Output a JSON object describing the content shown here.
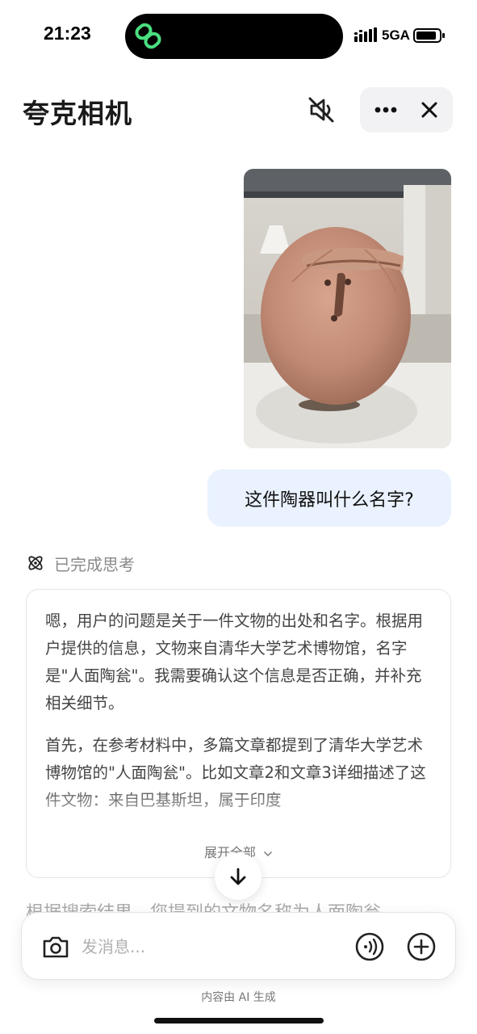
{
  "status_bar": {
    "time": "21:23",
    "network": "5GA",
    "island_icon": "link-rings-icon"
  },
  "header": {
    "title": "夸克相机",
    "icons": [
      "speaker-muted-icon",
      "more-icon",
      "close-icon"
    ]
  },
  "conversation": {
    "user_image": {
      "icon": "pottery-photo",
      "description_hidden": true
    },
    "user_message": "这件陶器叫什么名字?",
    "thinking": {
      "label": "已完成思考",
      "paragraphs": [
        "嗯，用户的问题是关于一件文物的出处和名字。根据用户提供的信息，文物来自清华大学艺术博物馆，名字是\"人面陶瓮\"。我需要确认这个信息是否正确，并补充相关细节。",
        "首先，在参考材料中，多篇文章都提到了清华大学艺术博物馆的\"人面陶瓮\"。比如文章2和文章3详细描述了这件文物：来自巴基斯坦，属于印度"
      ],
      "expand_label": "展开全部"
    },
    "answer_preview": "根据搜索结果，您提到的文物名称为人面陶瓮"
  },
  "input": {
    "placeholder": "发消息..."
  },
  "footer": {
    "note": "内容由 AI 生成"
  },
  "colors": {
    "accent_green": "#3ddc84",
    "user_bubble": "#e9f2fe"
  }
}
